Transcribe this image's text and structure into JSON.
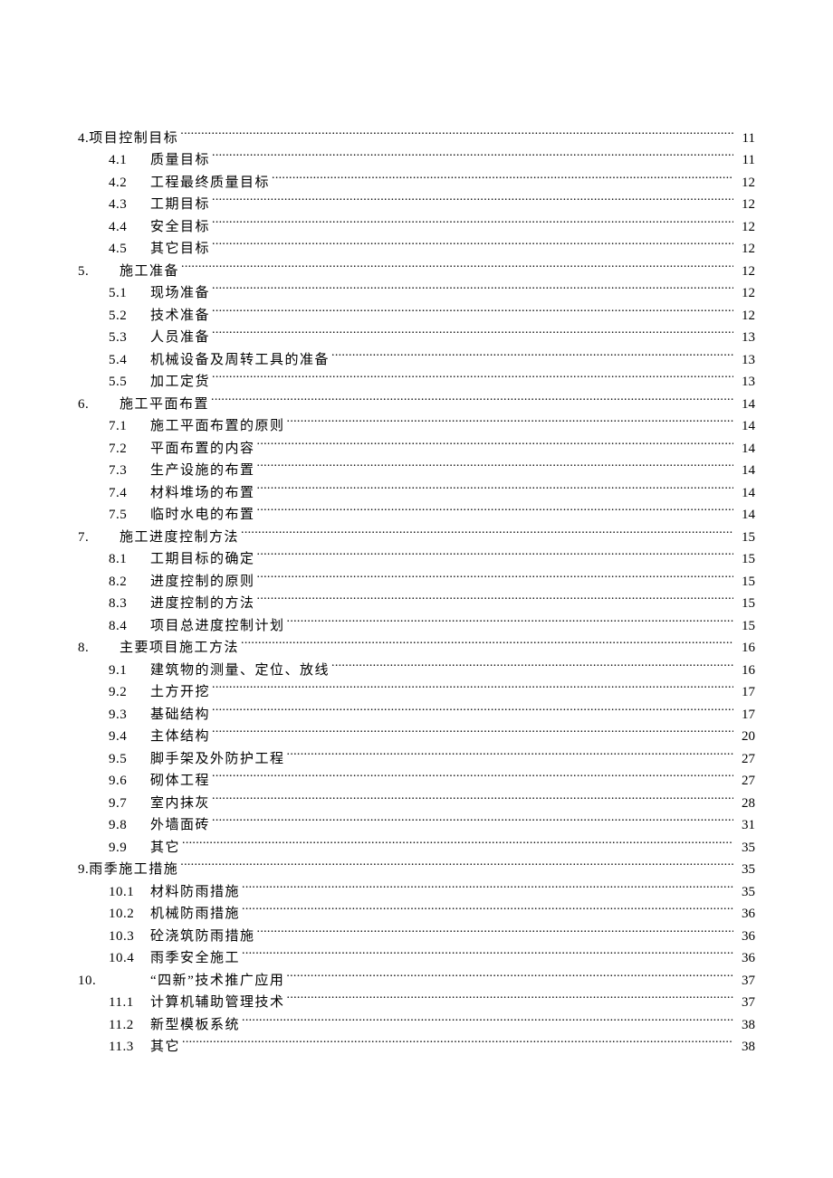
{
  "toc": [
    {
      "indent": 0,
      "number": "4.",
      "title": "项目控制目标",
      "page": "11",
      "joined": true
    },
    {
      "indent": 1,
      "number": "4.1",
      "title": "质量目标",
      "page": "11"
    },
    {
      "indent": 1,
      "number": "4.2",
      "title": "工程最终质量目标",
      "page": "12"
    },
    {
      "indent": 1,
      "number": "4.3",
      "title": "工期目标",
      "page": "12"
    },
    {
      "indent": 1,
      "number": "4.4",
      "title": "安全目标",
      "page": "12"
    },
    {
      "indent": 1,
      "number": "4.5",
      "title": "其它目标",
      "page": "12"
    },
    {
      "indent": 0,
      "number": "5.",
      "title": "施工准备",
      "page": "12"
    },
    {
      "indent": 1,
      "number": "5.1",
      "title": "现场准备",
      "page": "12"
    },
    {
      "indent": 1,
      "number": "5.2",
      "title": "技术准备",
      "page": "12"
    },
    {
      "indent": 1,
      "number": "5.3",
      "title": "人员准备",
      "page": "13"
    },
    {
      "indent": 1,
      "number": "5.4",
      "title": "机械设备及周转工具的准备",
      "page": "13"
    },
    {
      "indent": 1,
      "number": "5.5",
      "title": "加工定货",
      "page": "13"
    },
    {
      "indent": 0,
      "number": "6.",
      "title": "施工平面布置",
      "page": "14"
    },
    {
      "indent": 1,
      "number": "7.1",
      "title": "施工平面布置的原则",
      "page": "14"
    },
    {
      "indent": 1,
      "number": "7.2",
      "title": "平面布置的内容",
      "page": "14"
    },
    {
      "indent": 1,
      "number": "7.3",
      "title": "生产设施的布置",
      "page": "14"
    },
    {
      "indent": 1,
      "number": "7.4",
      "title": "材料堆场的布置",
      "page": "14"
    },
    {
      "indent": 1,
      "number": "7.5",
      "title": "临时水电的布置",
      "page": "14"
    },
    {
      "indent": 0,
      "number": "7.",
      "title": "施工进度控制方法",
      "page": "15"
    },
    {
      "indent": 1,
      "number": "8.1",
      "title": "工期目标的确定",
      "page": "15"
    },
    {
      "indent": 1,
      "number": "8.2",
      "title": "进度控制的原则",
      "page": "15"
    },
    {
      "indent": 1,
      "number": "8.3",
      "title": "进度控制的方法",
      "page": "15"
    },
    {
      "indent": 1,
      "number": "8.4",
      "title": "项目总进度控制计划",
      "page": "15"
    },
    {
      "indent": 0,
      "number": "8.",
      "title": "主要项目施工方法",
      "page": "16"
    },
    {
      "indent": 1,
      "number": "9.1",
      "title": "建筑物的测量、定位、放线",
      "page": "16"
    },
    {
      "indent": 1,
      "number": "9.2",
      "title": "土方开挖",
      "page": "17"
    },
    {
      "indent": 1,
      "number": "9.3",
      "title": "基础结构",
      "page": "17"
    },
    {
      "indent": 1,
      "number": "9.4",
      "title": "主体结构",
      "page": "20"
    },
    {
      "indent": 1,
      "number": "9.5",
      "title": "脚手架及外防护工程",
      "page": "27"
    },
    {
      "indent": 1,
      "number": "9.6",
      "title": "砌体工程",
      "page": "27"
    },
    {
      "indent": 1,
      "number": "9.7",
      "title": "室内抹灰",
      "page": "28"
    },
    {
      "indent": 1,
      "number": "9.8",
      "title": "外墙面砖",
      "page": "31"
    },
    {
      "indent": 1,
      "number": "9.9",
      "title": " 其它",
      "page": "35"
    },
    {
      "indent": 0,
      "number": "9.",
      "title": "雨季施工措施",
      "page": "35",
      "joined": true
    },
    {
      "indent": 1,
      "number": "10.1",
      "title": "材料防雨措施",
      "page": "35"
    },
    {
      "indent": 1,
      "number": "10.2",
      "title": " 机械防雨措施",
      "page": "36"
    },
    {
      "indent": 1,
      "number": "10.3",
      "title": " 砼浇筑防雨措施",
      "page": "36"
    },
    {
      "indent": 1,
      "number": "10.4",
      "title": " 雨季安全施工",
      "page": "36"
    },
    {
      "indent": 0,
      "number": "10.",
      "title": "“四新”技术推广应用",
      "page": "37",
      "wide": true
    },
    {
      "indent": 1,
      "number": "11.1",
      "title": "计算机辅助管理技术",
      "page": "37"
    },
    {
      "indent": 1,
      "number": "11.2",
      "title": "新型模板系统",
      "page": "38"
    },
    {
      "indent": 1,
      "number": "11.3",
      "title": "其它",
      "page": "38"
    }
  ]
}
